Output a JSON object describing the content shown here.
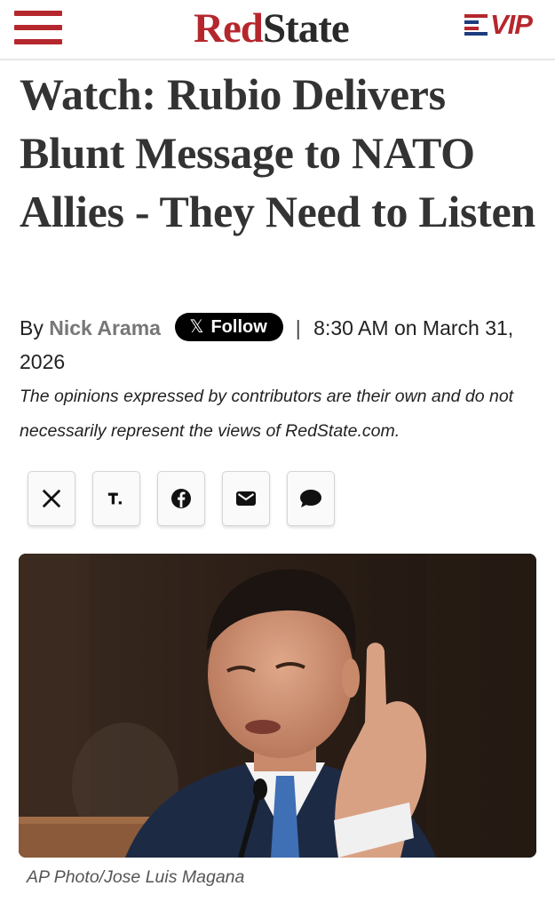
{
  "header": {
    "logo_red": "Red",
    "logo_state": "State",
    "vip_label": "VIP"
  },
  "article": {
    "headline": "Watch: Rubio Delivers Blunt Message to NATO Allies - They Need to Listen",
    "by_prefix": "By",
    "author": "Nick Arama",
    "follow_label": "Follow",
    "follow_x": "𝕏",
    "separator": "|",
    "timestamp": "8:30 AM on March 31, 2026",
    "disclaimer": "The opinions expressed by contributors are their own and do not necessarily represent the views of RedState.com.",
    "share_buttons": [
      "x-share",
      "truth-social-share",
      "facebook-share",
      "email-share",
      "comments"
    ],
    "photo_caption": "AP Photo/Jose Luis Magana"
  },
  "colors": {
    "brand_red": "#b5272d",
    "flag_blue": "#1c3c7c"
  }
}
